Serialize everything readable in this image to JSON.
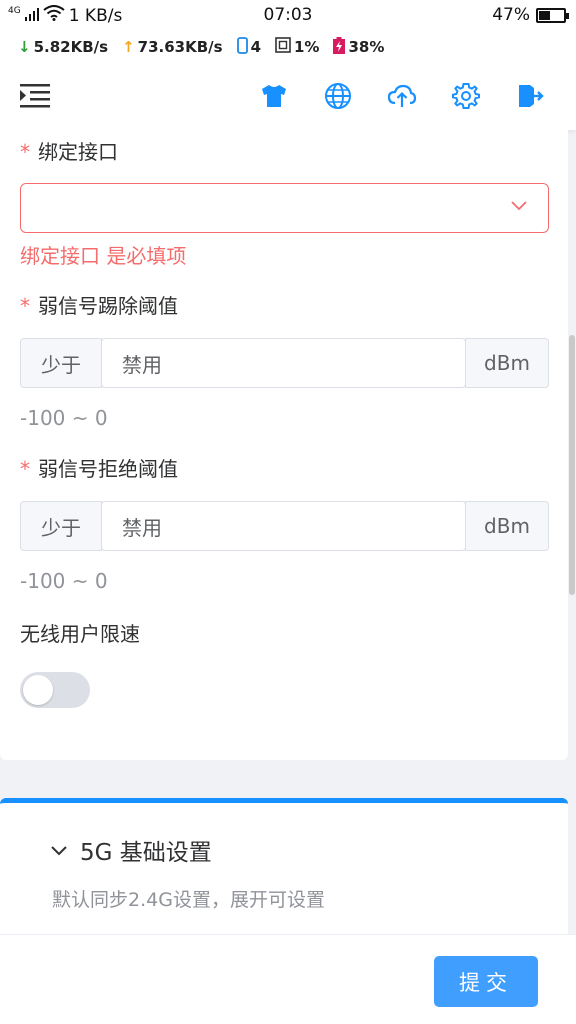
{
  "status_bar": {
    "network_type": "4G",
    "speed": "1 KB/s",
    "time": "07:03",
    "battery_percent": "47%",
    "battery_level": 0.47
  },
  "net_monitor": {
    "download": "5.82KB/s",
    "upload": "73.63KB/s",
    "devices": "4",
    "cpu": "1%",
    "battery": "38%"
  },
  "nav": {
    "icons": [
      "menu-icon",
      "shirt-icon",
      "globe-icon",
      "cloud-upload-icon",
      "gear-icon",
      "logout-icon"
    ],
    "accent_color": "#1890ff"
  },
  "form": {
    "bind_interface": {
      "required_mark": "*",
      "label": "绑定接口",
      "value": "",
      "error": "绑定接口 是必填项"
    },
    "weak_kick": {
      "required_mark": "*",
      "label": "弱信号踢除阈值",
      "prefix": "少于",
      "value": "禁用",
      "suffix": "dBm",
      "hint": "-100 ~ 0"
    },
    "weak_reject": {
      "required_mark": "*",
      "label": "弱信号拒绝阈值",
      "prefix": "少于",
      "value": "禁用",
      "suffix": "dBm",
      "hint": "-100 ~ 0"
    },
    "rate_limit": {
      "label": "无线用户限速",
      "enabled": false
    }
  },
  "section_5g": {
    "title": "5G 基础设置",
    "subtitle": "默认同步2.4G设置，展开可设置"
  },
  "footer": {
    "submit_label": "提交"
  },
  "colors": {
    "error": "#f56c6c",
    "primary_button": "#409eff",
    "accent": "#1890ff"
  }
}
